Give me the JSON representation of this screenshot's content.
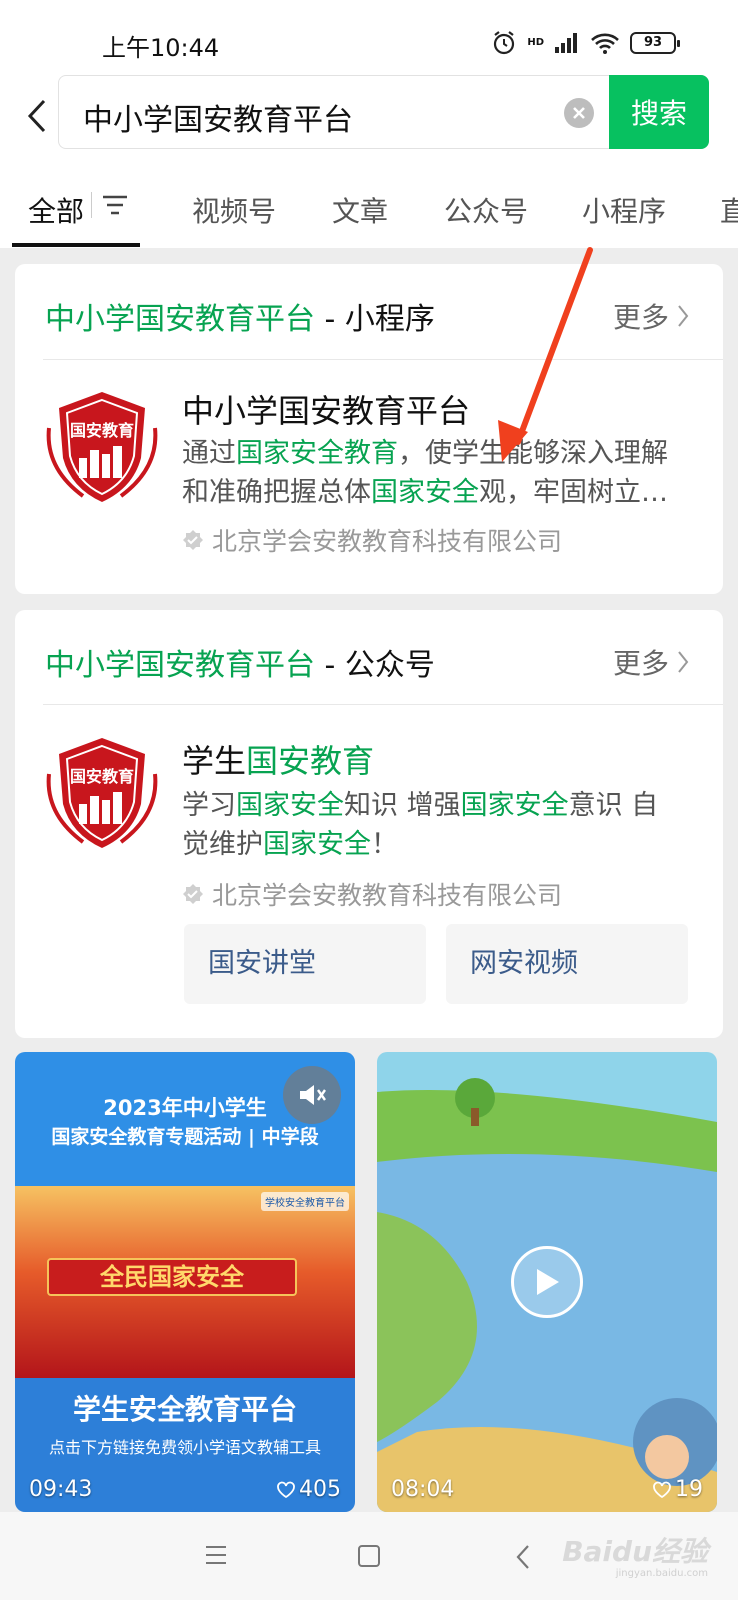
{
  "status_bar": {
    "time": "上午10:44",
    "battery": "93",
    "network_label": "HD"
  },
  "search": {
    "query": "中小学国安教育平台",
    "button_label": "搜索"
  },
  "tabs": [
    "全部",
    "视频号",
    "文章",
    "公众号",
    "小程序",
    "直"
  ],
  "mini_program_card": {
    "name": "中小学国安教育平台",
    "type_suffix": "- 小程序",
    "more_label": "更多",
    "item": {
      "logo_text": "国安教育",
      "title": "中小学国安教育平台",
      "desc_parts": [
        "通过",
        "国家安全教育",
        "，使学生能够深入理解和准确把握总体",
        "国家安全",
        "观，牢固树立…"
      ],
      "owner": "北京学会安教教育科技有限公司"
    }
  },
  "official_account_card": {
    "name": "中小学国安教育平台",
    "type_suffix": "- 公众号",
    "more_label": "更多",
    "item": {
      "logo_text": "国安教育",
      "title_plain": "学生",
      "title_highlight": "国安教育",
      "desc_parts": [
        "学习",
        "国家安全",
        "知识 增强",
        "国家安全",
        "意识 自觉维护",
        "国家安全",
        "！"
      ],
      "owner": "北京学会安教教育科技有限公司",
      "links": [
        "国安讲堂",
        "网安视频"
      ]
    }
  },
  "videos": [
    {
      "title_line1": "2023年中小学生",
      "title_line2": "国家安全教育专题活动 | 中学段",
      "banner": "全民国家安全",
      "logo": "学校安全教育平台",
      "bottom_title": "学生安全教育平台",
      "bottom_sub": "点击下方链接免费领小学语文教辅工具",
      "duration": "09:43",
      "likes": "405"
    },
    {
      "duration": "08:04",
      "likes": "19"
    }
  ],
  "watermark": {
    "text": "Baidu经验",
    "sub": "jingyan.baidu.com"
  },
  "colors": {
    "accent": "#07c160",
    "highlight": "#07a351",
    "annotation_arrow": "#f0401e"
  }
}
